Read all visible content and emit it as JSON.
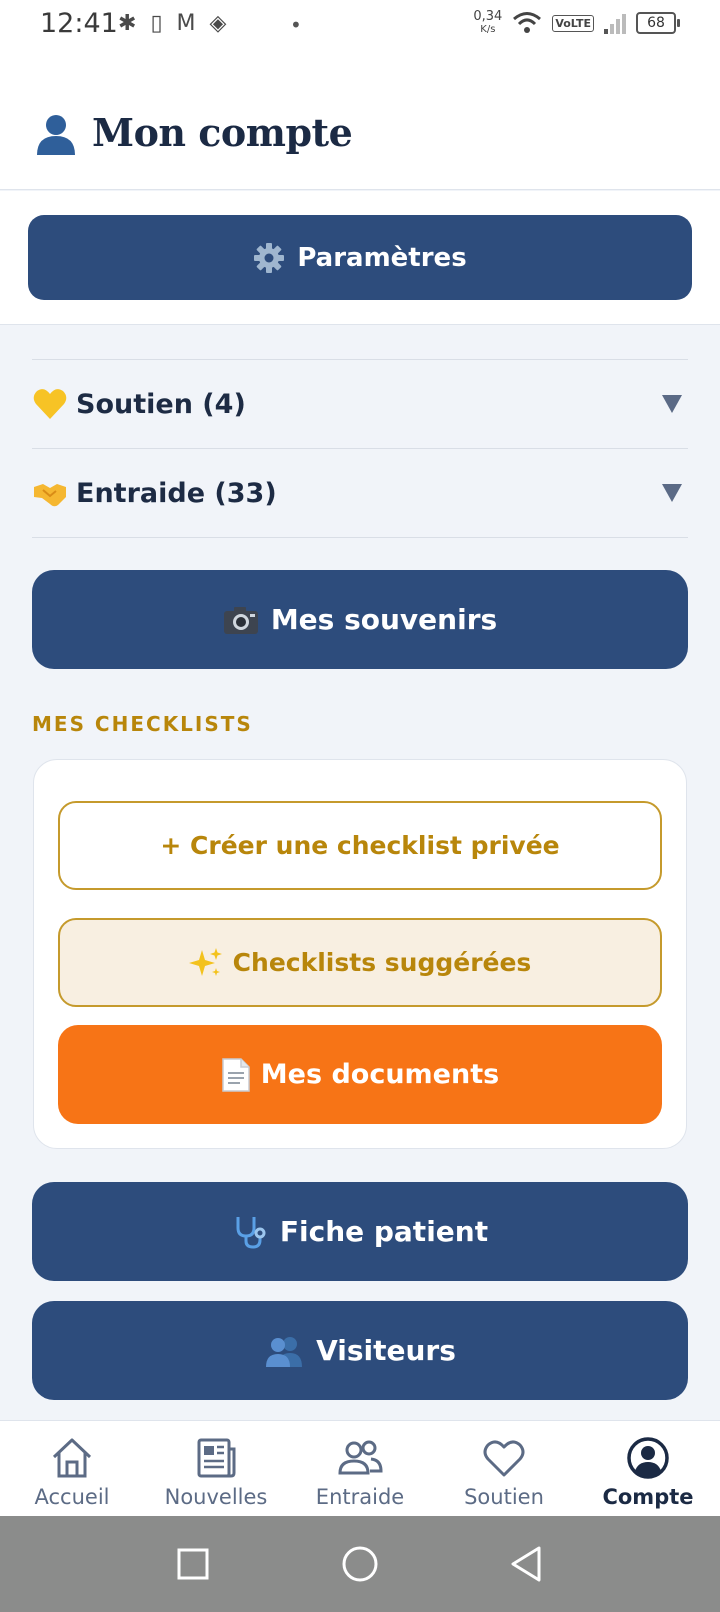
{
  "status_bar": {
    "time": "12:41",
    "icons": [
      "bluetooth-icon",
      "phone-icon",
      "gmail-icon",
      "app-icon"
    ],
    "speed_value": "0,34",
    "speed_unit": "K/s",
    "network": "VoLTE",
    "battery": "68"
  },
  "header": {
    "icon": "user-icon",
    "title": "Mon compte"
  },
  "settings": {
    "icon": "gear-icon",
    "label": "Paramètres"
  },
  "accordions": [
    {
      "icon": "yellow-heart-icon",
      "label": "Soutien (4)"
    },
    {
      "icon": "handshake-icon",
      "label": "Entraide (33)"
    }
  ],
  "souvenirs": {
    "icon": "camera-icon",
    "label": "Mes souvenirs"
  },
  "checklists": {
    "section_title": "MES CHECKLISTS",
    "create_label": "+ Créer une checklist privée",
    "suggested_label": "Checklists suggérées",
    "suggested_icon": "sparkles-icon",
    "documents_label": "Mes documents",
    "documents_icon": "document-icon"
  },
  "fiche_patient": {
    "icon": "stethoscope-icon",
    "label": "Fiche patient"
  },
  "visiteurs": {
    "icon": "visitors-icon",
    "label": "Visiteurs"
  },
  "bottom_nav": [
    {
      "icon": "home-icon",
      "label": "Accueil"
    },
    {
      "icon": "news-icon",
      "label": "Nouvelles"
    },
    {
      "icon": "people-icon",
      "label": "Entraide"
    },
    {
      "icon": "heart-icon",
      "label": "Soutien"
    },
    {
      "icon": "account-icon",
      "label": "Compte",
      "active": true
    }
  ],
  "colors": {
    "navy": "#2d4c7c",
    "gold": "#b8860b",
    "orange": "#f77416",
    "background": "#f1f4f9"
  }
}
